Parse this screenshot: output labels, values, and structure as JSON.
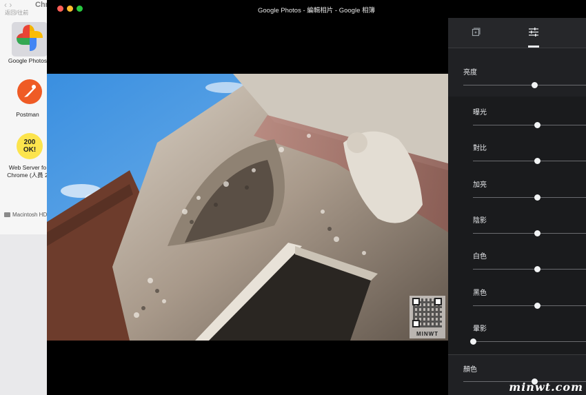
{
  "finder": {
    "nav_arrows": "‹  ›",
    "nav_label": "返回/往前",
    "title": "Chr",
    "apps": [
      {
        "label": "Google Photos",
        "icon": "google-photos-icon"
      },
      {
        "label": "Postman",
        "icon": "postman-icon"
      },
      {
        "label": "Web Server fo",
        "label2": "Chrome (人員 2",
        "icon": "web-server-icon",
        "icon_text": "200 OK!"
      }
    ],
    "disk": "Macintosh HD"
  },
  "window": {
    "title": "Google Photos - 編輯相片 - Google 相簿"
  },
  "photo": {
    "watermark": "MINWT"
  },
  "panel": {
    "tabs": [
      {
        "name": "filters",
        "icon": "photo-filter-icon"
      },
      {
        "name": "adjust",
        "icon": "tune-sliders-icon",
        "active": true
      }
    ],
    "light": {
      "label": "亮度",
      "value": 0.58
    },
    "light_sub": [
      {
        "label": "曝光",
        "value": 0.57
      },
      {
        "label": "對比",
        "value": 0.57
      },
      {
        "label": "加亮",
        "value": 0.57
      },
      {
        "label": "陰影",
        "value": 0.57
      },
      {
        "label": "白色",
        "value": 0.57
      },
      {
        "label": "黑色",
        "value": 0.57
      },
      {
        "label": "暈影",
        "value": 0.0
      }
    ],
    "color": {
      "label": "顏色",
      "value": 0.58
    }
  },
  "site_watermark": "minwt.com",
  "colors": {
    "panel_bg": "#202124",
    "accent_knob": "#f1f3f4",
    "sky": "#4a90d9"
  }
}
